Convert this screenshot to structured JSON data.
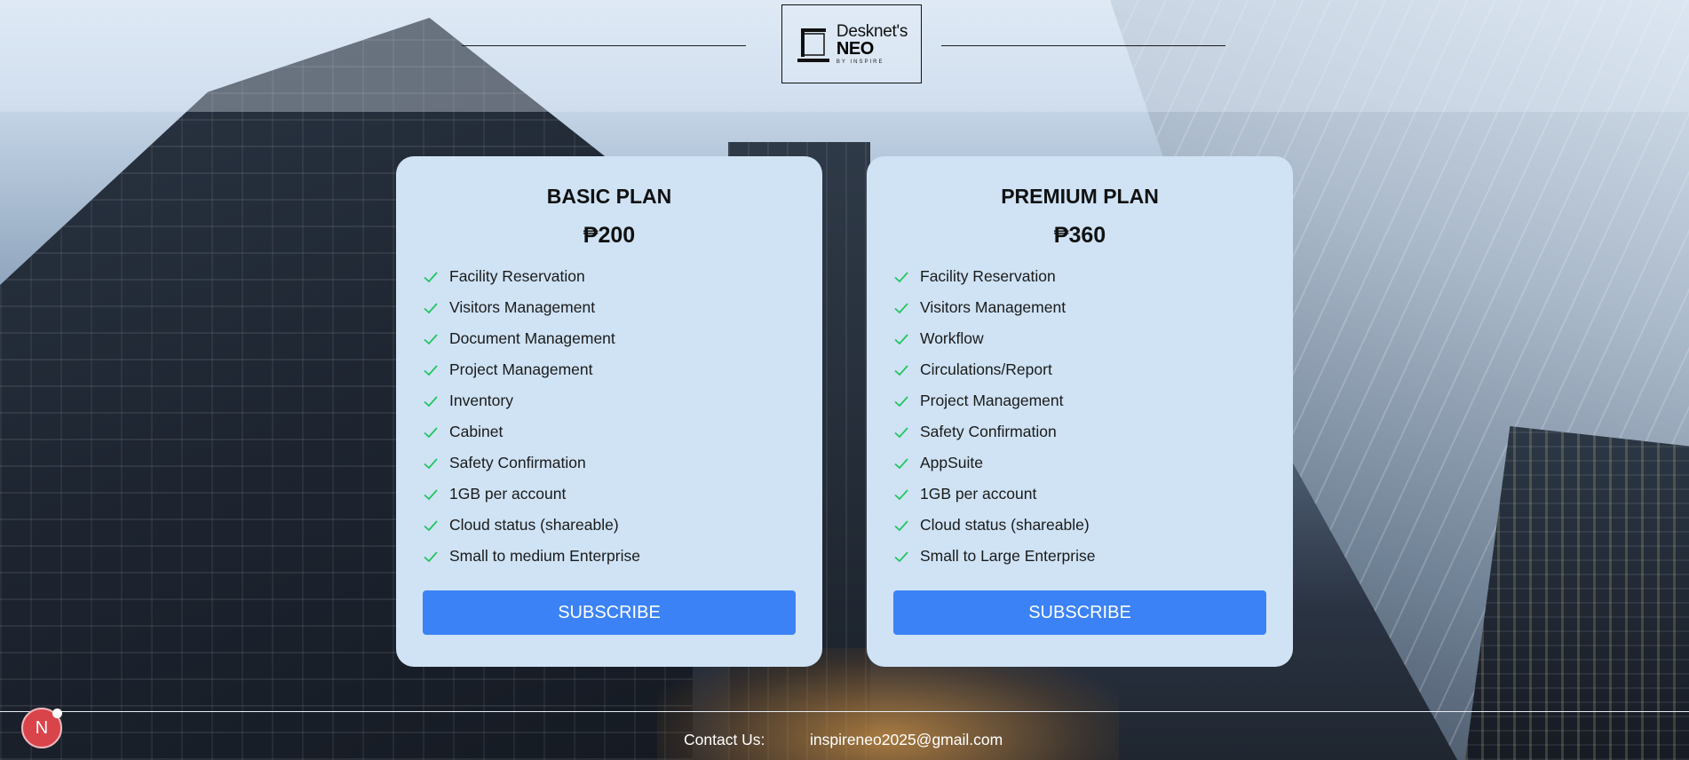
{
  "header": {
    "logo": {
      "brand": "Desknet's",
      "product": "NEO",
      "byline": "BY INSPIRE"
    }
  },
  "plans": [
    {
      "title": "BASIC PLAN",
      "price": "₱200",
      "features": [
        "Facility Reservation",
        "Visitors Management",
        "Document Management",
        "Project Management",
        "Inventory",
        "Cabinet",
        "Safety Confirmation",
        "1GB per account",
        "Cloud status (shareable)",
        "Small to medium Enterprise"
      ],
      "button_label": "SUBSCRIBE"
    },
    {
      "title": "PREMIUM PLAN",
      "price": "₱360",
      "features": [
        "Facility Reservation",
        "Visitors Management",
        "Workflow",
        "Circulations/Report",
        "Project Management",
        "Safety Confirmation",
        "AppSuite",
        "1GB per account",
        "Cloud status (shareable)",
        "Small to Large Enterprise"
      ],
      "button_label": "SUBSCRIBE"
    }
  ],
  "footer": {
    "contact_label": "Contact Us:",
    "email": "inspireneo2025@gmail.com"
  },
  "fab": {
    "label": "N"
  },
  "colors": {
    "card_bg": "#cfe3f5",
    "button_bg": "#3b82f6",
    "check": "#22c55e",
    "fab_bg": "#d9434a"
  },
  "icons": {
    "feature": "check-icon",
    "logo": "laptop-icon"
  }
}
